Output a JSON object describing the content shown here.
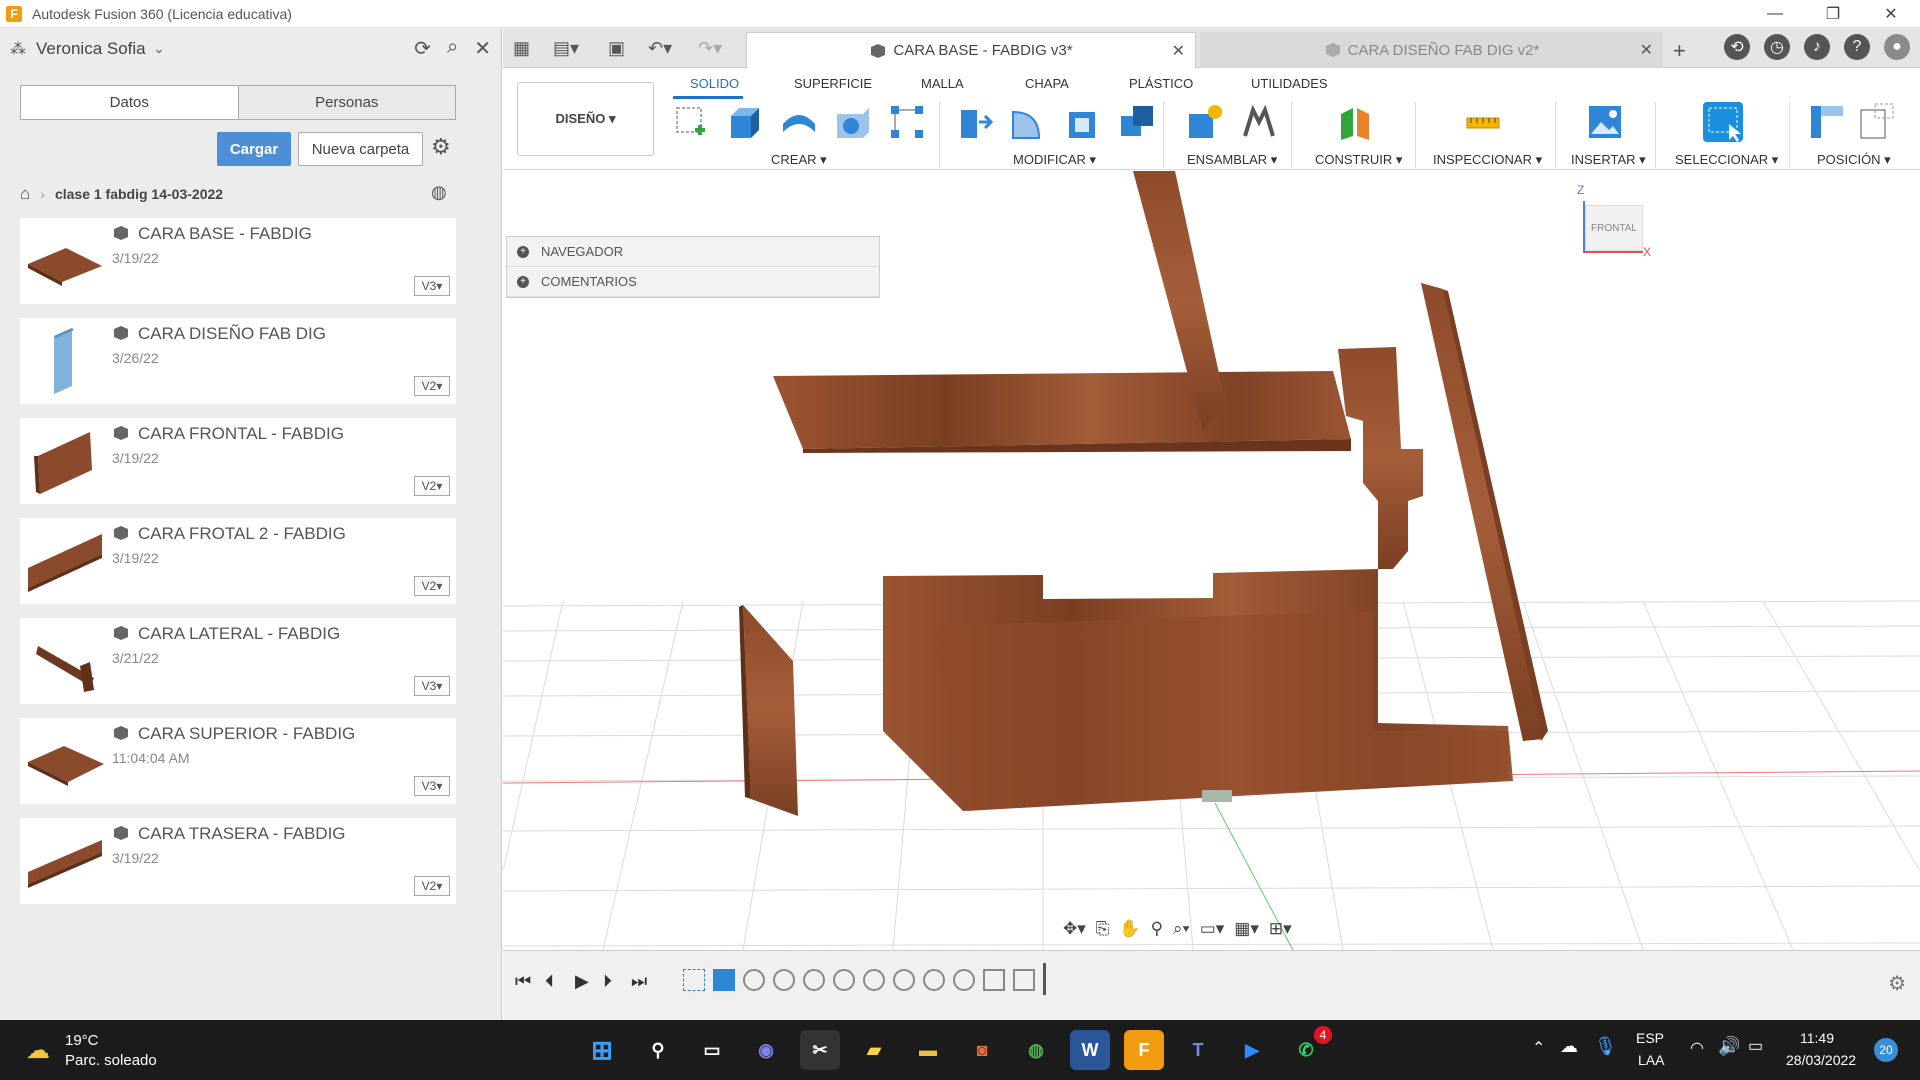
{
  "app": {
    "title": "Autodesk Fusion 360 (Licencia educativa)",
    "logo_letter": "F"
  },
  "left_panel": {
    "user_name": "Veronica Sofia",
    "tabs": [
      "Datos",
      "Personas"
    ],
    "upload_label": "Cargar",
    "new_folder_label": "Nueva carpeta",
    "breadcrumb_folder": "clase 1 fabdig 14-03-2022",
    "files": [
      {
        "name": "CARA BASE - FABDIG",
        "date": "3/19/22",
        "version": "V3"
      },
      {
        "name": "CARA DISEÑO FAB DIG",
        "date": "3/26/22",
        "version": "V2"
      },
      {
        "name": "CARA FRONTAL - FABDIG",
        "date": "3/19/22",
        "version": "V2"
      },
      {
        "name": "CARA FROTAL 2 - FABDIG",
        "date": "3/19/22",
        "version": "V2"
      },
      {
        "name": "CARA LATERAL - FABDIG",
        "date": "3/21/22",
        "version": "V3"
      },
      {
        "name": "CARA SUPERIOR - FABDIG",
        "date": "11:04:04 AM",
        "version": "V3"
      },
      {
        "name": "CARA TRASERA - FABDIG",
        "date": "3/19/22",
        "version": "V2"
      }
    ]
  },
  "doc_tabs": [
    {
      "label": "CARA BASE - FABDIG v3*",
      "active": true
    },
    {
      "label": "CARA DISEÑO FAB DIG v2*",
      "active": false
    }
  ],
  "ribbon": {
    "workspace": "DISEÑO ▾",
    "tabs": [
      "SOLIDO",
      "SUPERFICIE",
      "MALLA",
      "CHAPA",
      "PLÁSTICO",
      "UTILIDADES"
    ],
    "groups": [
      "CREAR ▾",
      "MODIFICAR ▾",
      "ENSAMBLAR ▾",
      "CONSTRUIR ▾",
      "INSPECCIONAR ▾",
      "INSERTAR ▾",
      "SELECCIONAR ▾",
      "POSICIÓN ▾"
    ]
  },
  "browser": {
    "rows": [
      "NAVEGADOR",
      "COMENTARIOS"
    ]
  },
  "viewcube": {
    "face": "FRONTAL",
    "axis_z": "Z",
    "axis_x": "X"
  },
  "taskbar": {
    "temperature": "19°C",
    "weather": "Parc. soleado",
    "language": "ESP",
    "layout": "LAA",
    "time": "11:49",
    "date": "28/03/2022",
    "whatsapp_badge": "4",
    "notification_count": "20"
  },
  "colors": {
    "accent": "#1a73c7",
    "upload_button": "#4d8ed6",
    "wood": "#8b4a2b"
  }
}
